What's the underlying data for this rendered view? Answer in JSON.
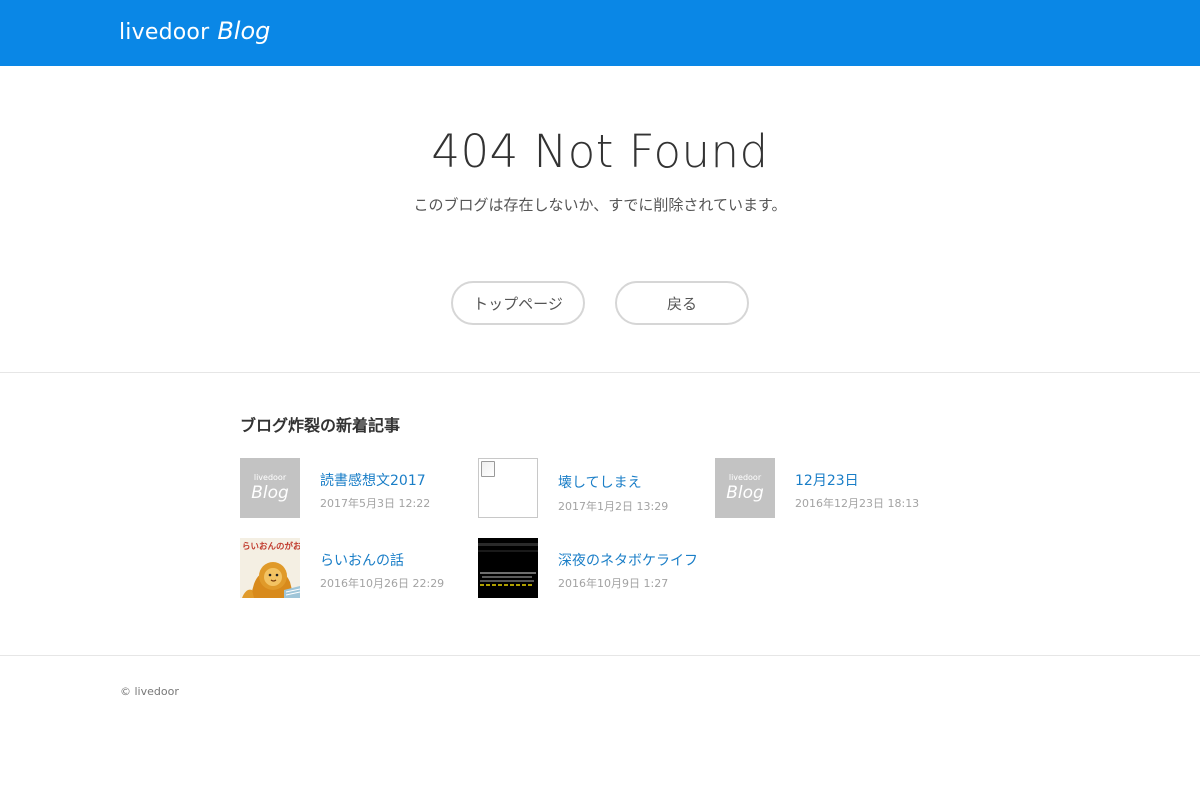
{
  "header": {
    "logo_main": "livedoor",
    "logo_sub": "Blog"
  },
  "error": {
    "title": "404 Not Found",
    "message": "このブログは存在しないか、すでに削除されています。"
  },
  "buttons": {
    "top_page": "トップページ",
    "back": "戻る"
  },
  "recent": {
    "heading": "ブログ炸裂の新着記事",
    "thumb_logo_main": "livedoor",
    "thumb_logo_sub": "Blog",
    "items": [
      {
        "title": "読書感想文2017",
        "date": "2017年5月3日 12:22",
        "thumb": "blog-logo"
      },
      {
        "title": "壊してしまえ",
        "date": "2017年1月2日 13:29",
        "thumb": "broken-image"
      },
      {
        "title": "12月23日",
        "date": "2016年12月23日 18:13",
        "thumb": "blog-logo"
      },
      {
        "title": "らいおんの話",
        "date": "2016年10月26日 22:29",
        "thumb": "lion-picture"
      },
      {
        "title": "深夜のネタボケライフ",
        "date": "2016年10月9日 1:27",
        "thumb": "dark-screenshot"
      }
    ],
    "lion_caption": "らいおんのがお"
  },
  "footer": {
    "copyright": "© livedoor"
  },
  "colors": {
    "header": "#0a87e6",
    "link": "#1a7ec7",
    "date": "#a3a3a3",
    "thumb_gray": "#c3c3c3"
  }
}
